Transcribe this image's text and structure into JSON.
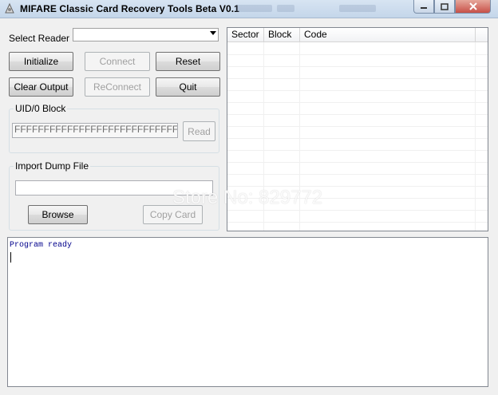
{
  "window": {
    "title": "MIFARE Classic Card Recovery Tools Beta V0.1"
  },
  "reader": {
    "label": "Select Reader",
    "selected": ""
  },
  "buttons": {
    "initialize": "Initialize",
    "connect": "Connect",
    "reset": "Reset",
    "clear_output": "Clear Output",
    "reconnect": "ReConnect",
    "quit": "Quit",
    "read": "Read",
    "browse": "Browse",
    "copy_card": "Copy Card"
  },
  "uid_block": {
    "title": "UID/0 Block",
    "value": "FFFFFFFFFFFFFFFFFFFFFFFFFFFFFFFF"
  },
  "import_dump": {
    "title": "Import Dump File",
    "value": ""
  },
  "table": {
    "columns": [
      "Sector",
      "Block",
      "Code"
    ],
    "rows": []
  },
  "output": {
    "text": "Program ready"
  },
  "watermark": "Store No: 829772",
  "icons": {
    "app": "card-app-icon",
    "minimize": "minimize-icon",
    "maximize": "maximize-icon",
    "close": "close-icon"
  },
  "colors": {
    "output_text": "#00008b",
    "titlebar": "#c4d6ea",
    "close_button": "#c75048"
  }
}
